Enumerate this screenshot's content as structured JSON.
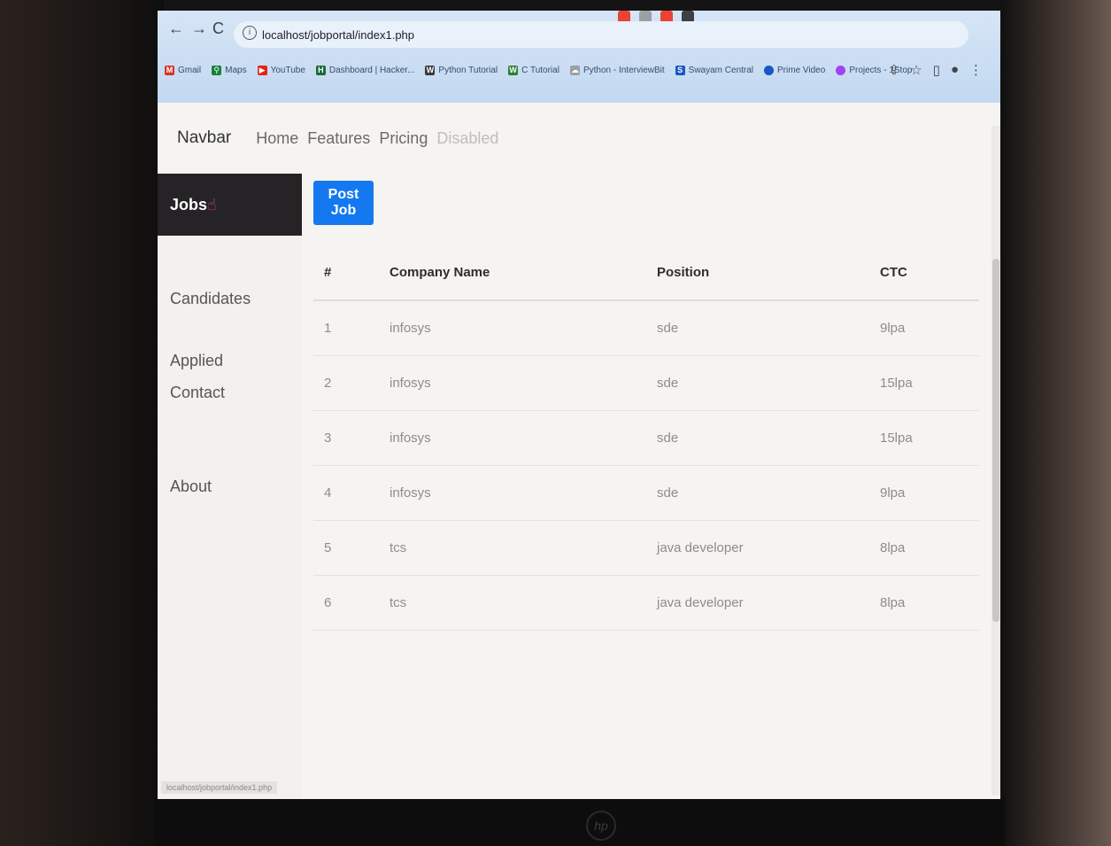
{
  "browser": {
    "url": "localhost/jobportal/index1.php",
    "back_icon": "arrow-left-icon",
    "forward_icon": "arrow-right-icon",
    "reload_icon": "reload-icon",
    "bookmarks": [
      {
        "label": "Gmail",
        "icon": "M",
        "color": "#d93025"
      },
      {
        "label": "Maps",
        "icon": "⚲",
        "color": "#188038"
      },
      {
        "label": "YouTube",
        "icon": "▶",
        "color": "#e62117"
      },
      {
        "label": "Dashboard | Hacker...",
        "icon": "H",
        "color": "#1a6a3b"
      },
      {
        "label": "Python Tutorial",
        "icon": "W",
        "color": "#3a3a3a"
      },
      {
        "label": "C Tutorial",
        "icon": "W",
        "color": "#2f7d32"
      },
      {
        "label": "Python - InterviewBit",
        "icon": "☁",
        "color": "#9aa0a6"
      },
      {
        "label": "Swayam Central",
        "icon": "S",
        "color": "#1a56c4"
      },
      {
        "label": "Prime Video",
        "icon": "●",
        "color": "#1a56c4"
      },
      {
        "label": "Projects - 1Stop",
        "icon": "●",
        "color": "#a142f4"
      }
    ],
    "status_url": "localhost/jobportal/index1.php"
  },
  "navbar": {
    "brand": "Navbar",
    "links": [
      "Home",
      "Features",
      "Pricing"
    ],
    "disabled_link": "Disabled"
  },
  "sidebar": {
    "items": [
      "Jobs",
      "Candidates Applied",
      "Contact",
      "About"
    ]
  },
  "post_button": "Post Job",
  "table": {
    "headers": [
      "#",
      "Company Name",
      "Position",
      "CTC"
    ],
    "rows": [
      [
        "1",
        "infosys",
        "sde",
        "9lpa"
      ],
      [
        "2",
        "infosys",
        "sde",
        "15lpa"
      ],
      [
        "3",
        "infosys",
        "sde",
        "15lpa"
      ],
      [
        "4",
        "infosys",
        "sde",
        "9lpa"
      ],
      [
        "5",
        "tcs",
        "java developer",
        "8lpa"
      ],
      [
        "6",
        "tcs",
        "java developer",
        "8lpa"
      ]
    ]
  }
}
